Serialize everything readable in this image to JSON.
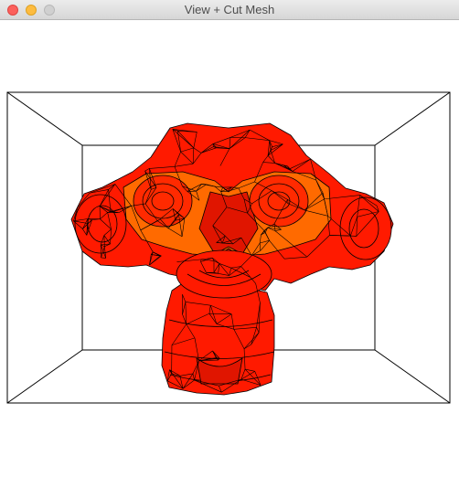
{
  "window": {
    "title": "View + Cut Mesh"
  },
  "scene": {
    "background": "#ffffff",
    "box_color": "#000000",
    "mesh": "monkey-head",
    "mesh_colors": {
      "main": "#ff1a00",
      "dark": "#e01500",
      "orange": "#ff6a00",
      "wire": "#000000"
    }
  }
}
